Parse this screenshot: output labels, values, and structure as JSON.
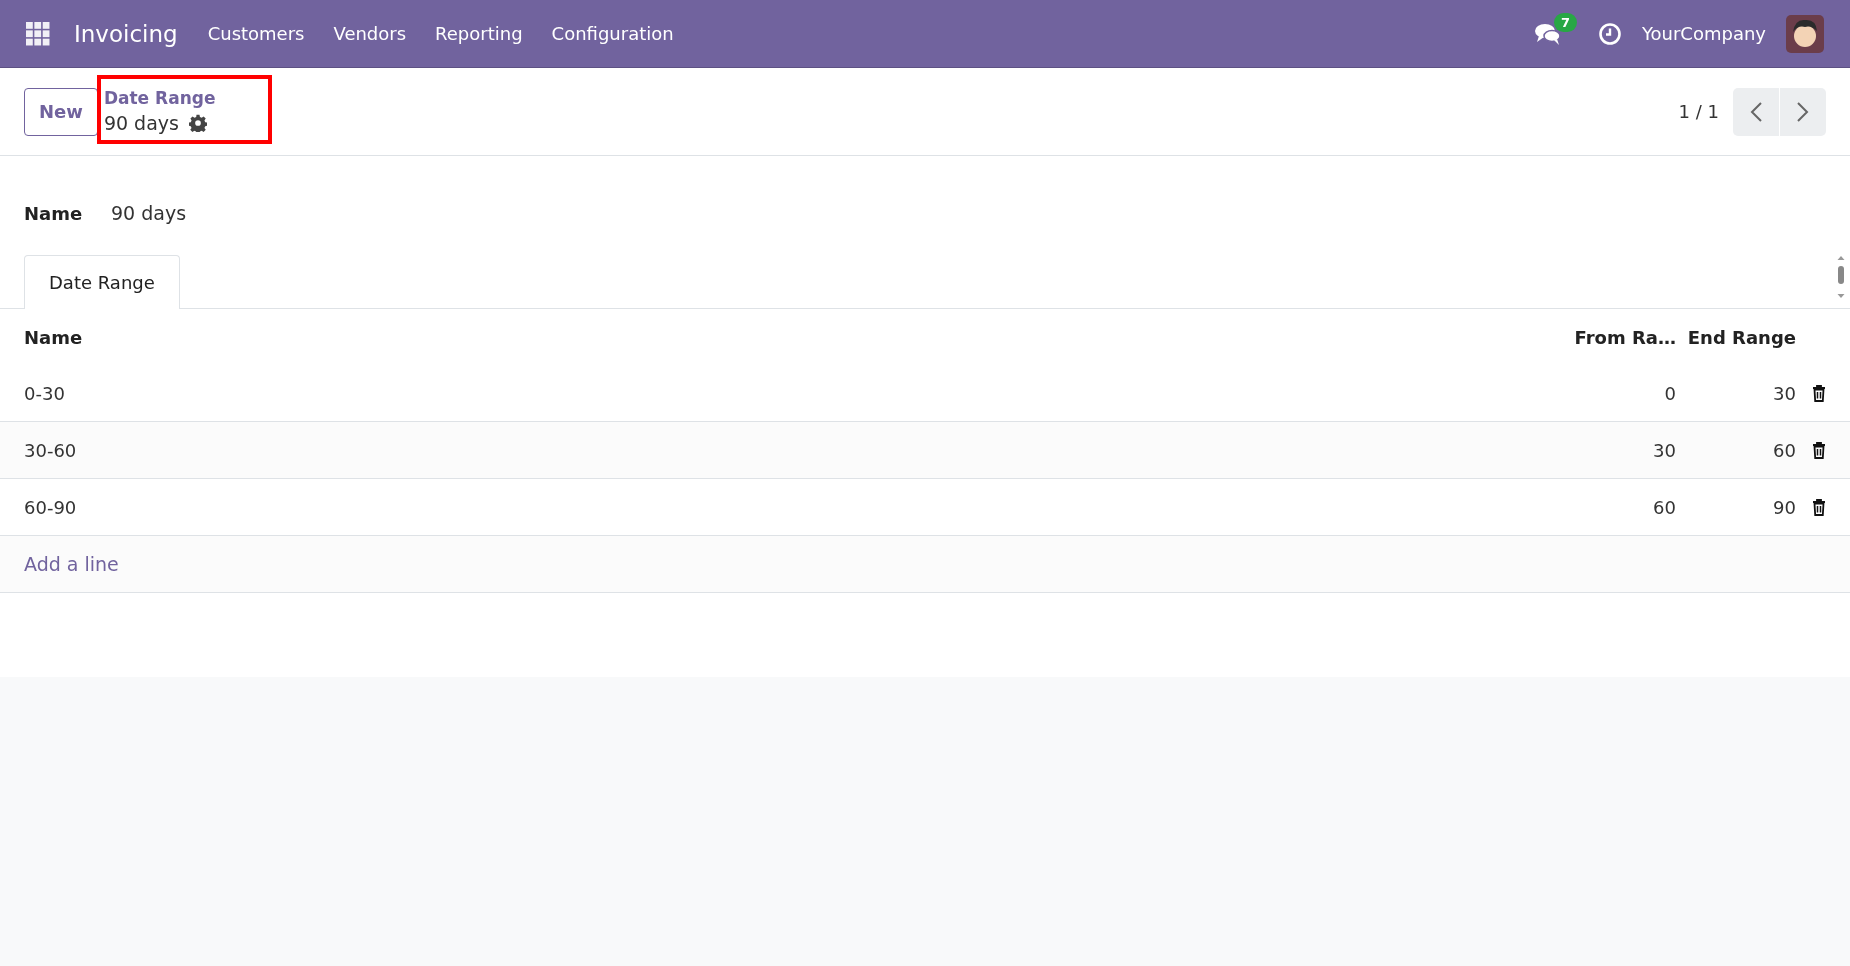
{
  "navbar": {
    "app_name": "Invoicing",
    "menu": [
      "Customers",
      "Vendors",
      "Reporting",
      "Configuration"
    ],
    "messages_count": "7",
    "company": "YourCompany"
  },
  "control_panel": {
    "new_button": "New",
    "breadcrumb": "Date Range",
    "record": "90 days",
    "pager": "1 / 1"
  },
  "form": {
    "name_label": "Name",
    "name_value": "90 days"
  },
  "tabs": [
    {
      "label": "Date Range",
      "selected": true
    }
  ],
  "table": {
    "columns": [
      "Name",
      "From Ra…",
      "End Range"
    ],
    "rows": [
      {
        "cells": [
          "0-30",
          "0",
          "30"
        ]
      },
      {
        "cells": [
          "30-60",
          "30",
          "60"
        ]
      },
      {
        "cells": [
          "60-90",
          "60",
          "90"
        ]
      }
    ],
    "add_line": "Add a line"
  }
}
